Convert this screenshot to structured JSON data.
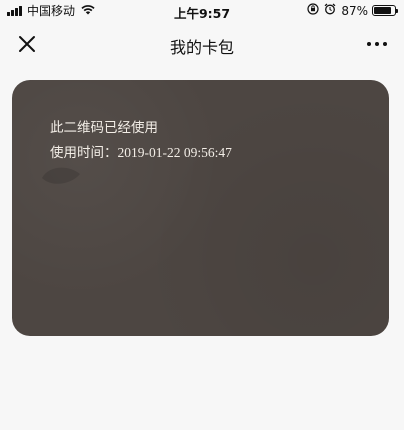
{
  "status_bar": {
    "carrier": "中国移动",
    "time": "上午9:57",
    "battery_percent": "87%",
    "battery_level": 0.87,
    "icons": [
      "signal-icon",
      "wifi-icon",
      "orientation-lock-icon",
      "alarm-icon",
      "battery-icon"
    ]
  },
  "nav": {
    "title": "我的卡包",
    "close_icon": "close-icon",
    "more_icon": "more-icon"
  },
  "card": {
    "message": "此二维码已经使用",
    "used_time_label": "使用时间：",
    "used_time_value": "2019-01-22 09:56:47",
    "background_color": "#4d4642",
    "text_color": "#f2ede6"
  }
}
